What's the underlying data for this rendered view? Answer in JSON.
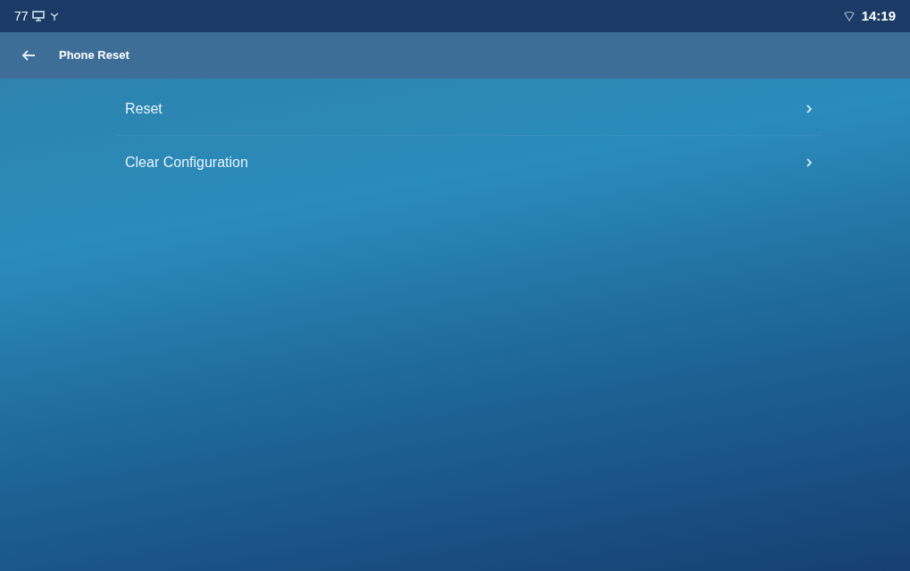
{
  "status_bar": {
    "left_text": "77",
    "time": "14:19"
  },
  "title_bar": {
    "title": "Phone Reset"
  },
  "menu_items": [
    {
      "label": "Reset"
    },
    {
      "label": "Clear Configuration"
    }
  ]
}
